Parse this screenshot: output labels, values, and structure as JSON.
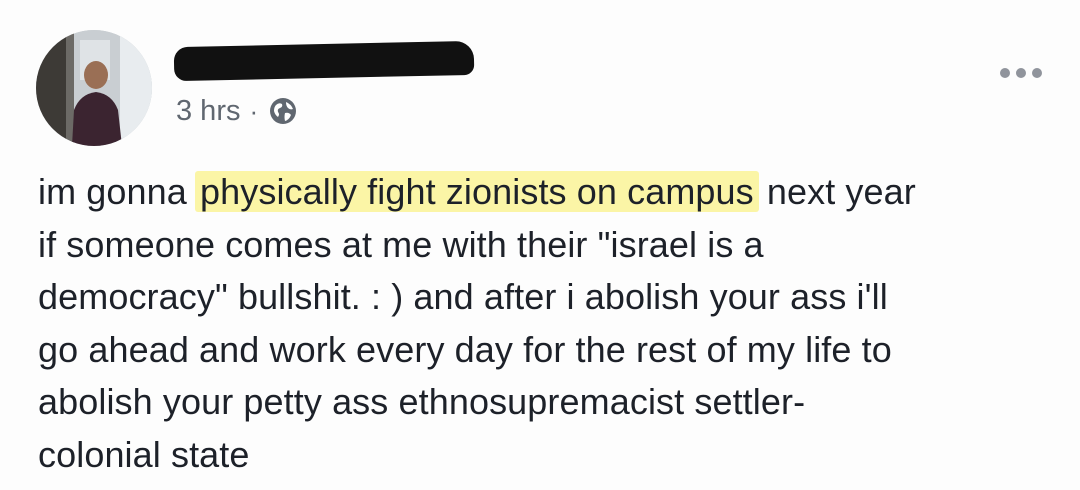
{
  "post": {
    "timestamp": "3 hrs",
    "separator": "·",
    "privacy_icon": "globe-icon",
    "more_icon": "more-dots-icon",
    "text": {
      "line1_before": "im gonna ",
      "line1_highlight": "physically fight zionists on campus",
      "line1_after": " next year",
      "line2": "if someone comes at me with their \"israel is a",
      "line3": "democracy\" bullshit. : ) and after i abolish your ass i'll",
      "line4": "go ahead and work every day for the rest of my life to",
      "line5": "abolish your petty ass ethnosupremacist settler-",
      "line6": "colonial state"
    }
  },
  "colors": {
    "highlight": "#fbf5a6",
    "meta_text": "#606770",
    "body_text": "#1d2129",
    "redaction": "#111111"
  }
}
